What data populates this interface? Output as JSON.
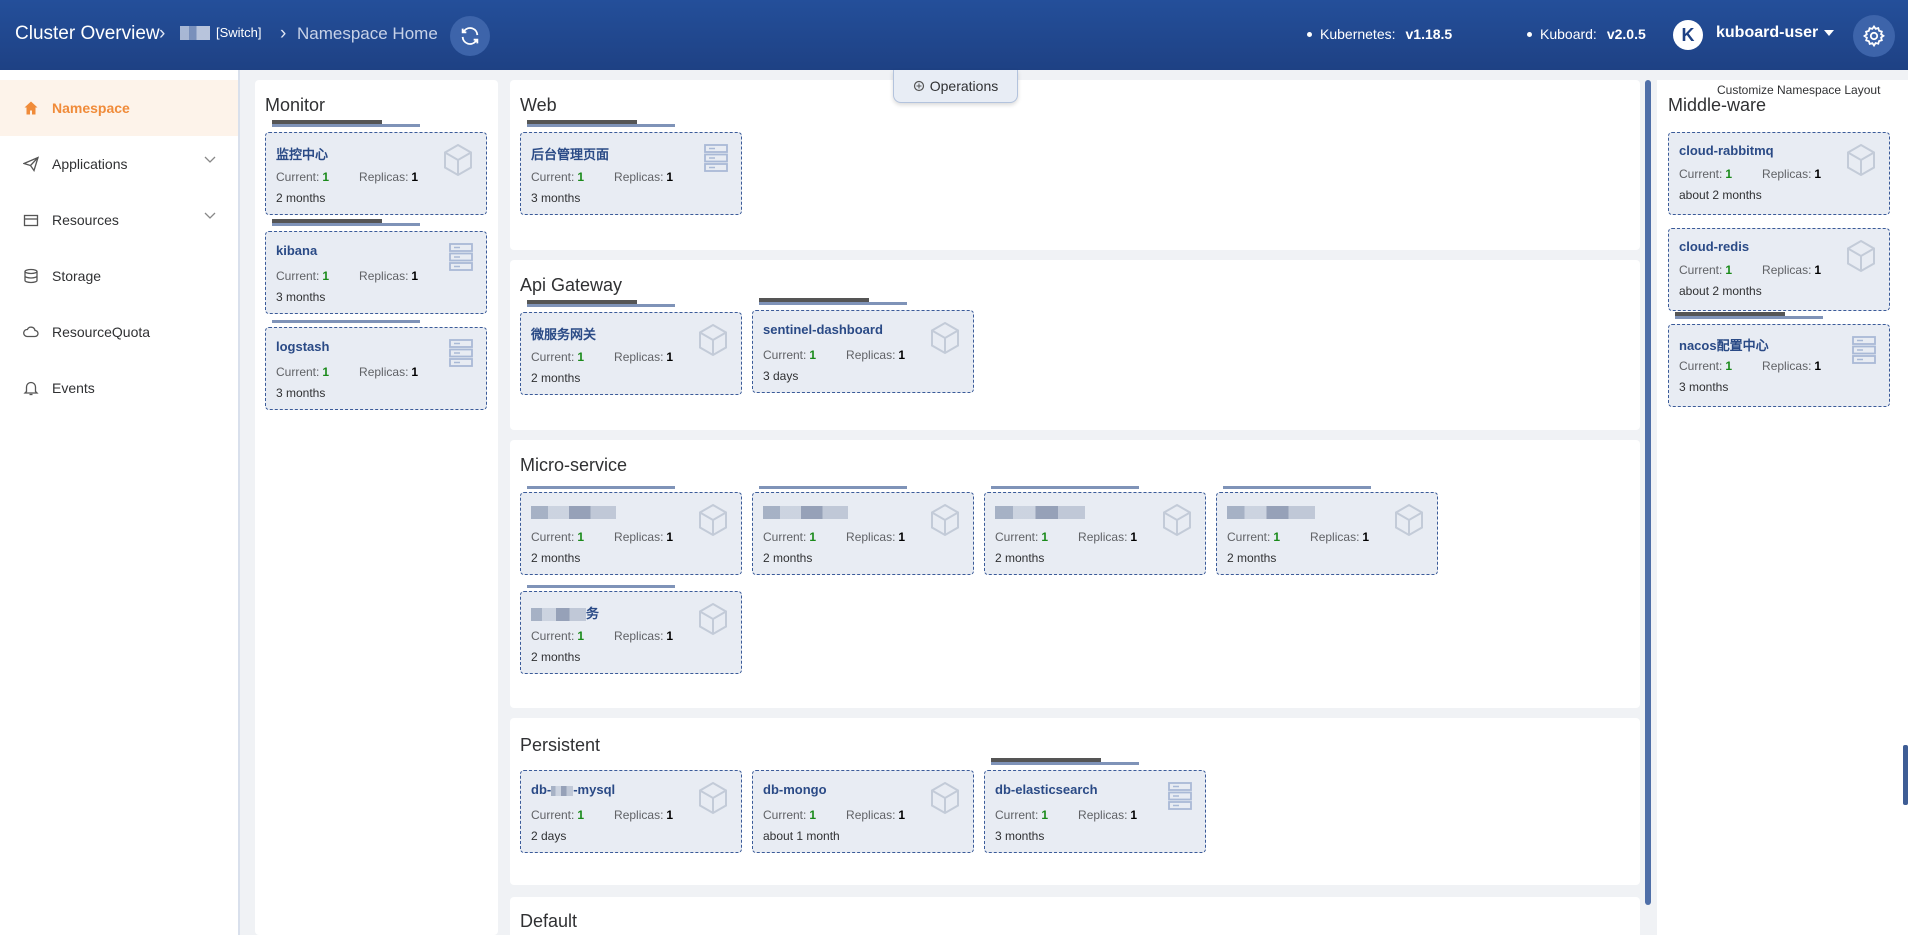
{
  "header": {
    "breadcrumb_root": "Cluster Overview",
    "switch_label": "[Switch]",
    "breadcrumb_current": "Namespace Home",
    "kubernetes_label": "Kubernetes:",
    "kubernetes_version": "v1.18.5",
    "kuboard_label": "Kuboard:",
    "kuboard_version": "v2.0.5",
    "avatar_letter": "K",
    "user_name": "kuboard-user"
  },
  "sidebar": {
    "items": [
      {
        "label": "Namespace",
        "icon": "home-icon",
        "active": true
      },
      {
        "label": "Applications",
        "icon": "paper-plane-icon",
        "expandable": true
      },
      {
        "label": "Resources",
        "icon": "box-icon",
        "expandable": true
      },
      {
        "label": "Storage",
        "icon": "database-icon"
      },
      {
        "label": "ResourceQuota",
        "icon": "cloud-icon"
      },
      {
        "label": "Events",
        "icon": "bell-icon"
      }
    ]
  },
  "toolbar": {
    "operations_label": "Operations",
    "customize_label": "Customize Namespace Layout"
  },
  "labels": {
    "current": "Current:",
    "replicas": "Replicas:"
  },
  "sections": {
    "monitor": "Monitor",
    "web": "Web",
    "api_gateway": "Api Gateway",
    "micro_service": "Micro-service",
    "persistent": "Persistent",
    "default": "Default",
    "middle_ware": "Middle-ware"
  },
  "cards": {
    "monitor": [
      {
        "name": "监控中心",
        "current": "1",
        "replicas": "1",
        "age": "2 months"
      },
      {
        "name": "kibana",
        "current": "1",
        "replicas": "1",
        "age": "3 months"
      },
      {
        "name": "logstash",
        "current": "1",
        "replicas": "1",
        "age": "3 months"
      }
    ],
    "web": [
      {
        "name": "后台管理页面",
        "current": "1",
        "replicas": "1",
        "age": "3 months"
      }
    ],
    "api_gateway": [
      {
        "name": "微服务网关",
        "current": "1",
        "replicas": "1",
        "age": "2 months"
      },
      {
        "name": "sentinel-dashboard",
        "current": "1",
        "replicas": "1",
        "age": "3 days"
      }
    ],
    "micro_service": [
      {
        "name": "",
        "current": "1",
        "replicas": "1",
        "age": "2 months"
      },
      {
        "name": "",
        "current": "1",
        "replicas": "1",
        "age": "2 months"
      },
      {
        "name": "",
        "current": "1",
        "replicas": "1",
        "age": "2 months"
      },
      {
        "name": "",
        "current": "1",
        "replicas": "1",
        "age": "2 months"
      },
      {
        "name": "务",
        "current": "1",
        "replicas": "1",
        "age": "2 months"
      }
    ],
    "persistent": [
      {
        "name_prefix": "db-",
        "name_suffix": "-mysql",
        "current": "1",
        "replicas": "1",
        "age": "2 days"
      },
      {
        "name": "db-mongo",
        "current": "1",
        "replicas": "1",
        "age": "about 1 month"
      },
      {
        "name": "db-elasticsearch",
        "current": "1",
        "replicas": "1",
        "age": "3 months"
      }
    ],
    "middle_ware": [
      {
        "name": "cloud-rabbitmq",
        "current": "1",
        "replicas": "1",
        "age": "about 2 months"
      },
      {
        "name": "cloud-redis",
        "current": "1",
        "replicas": "1",
        "age": "about 2 months"
      },
      {
        "name": "nacos配置中心",
        "current": "1",
        "replicas": "1",
        "age": "3 months"
      }
    ]
  },
  "colors": {
    "header_bg": "#1e4184",
    "accent_active": "#f08b3a",
    "card_border": "#3b5b99",
    "current_value": "#1a8a1a"
  }
}
